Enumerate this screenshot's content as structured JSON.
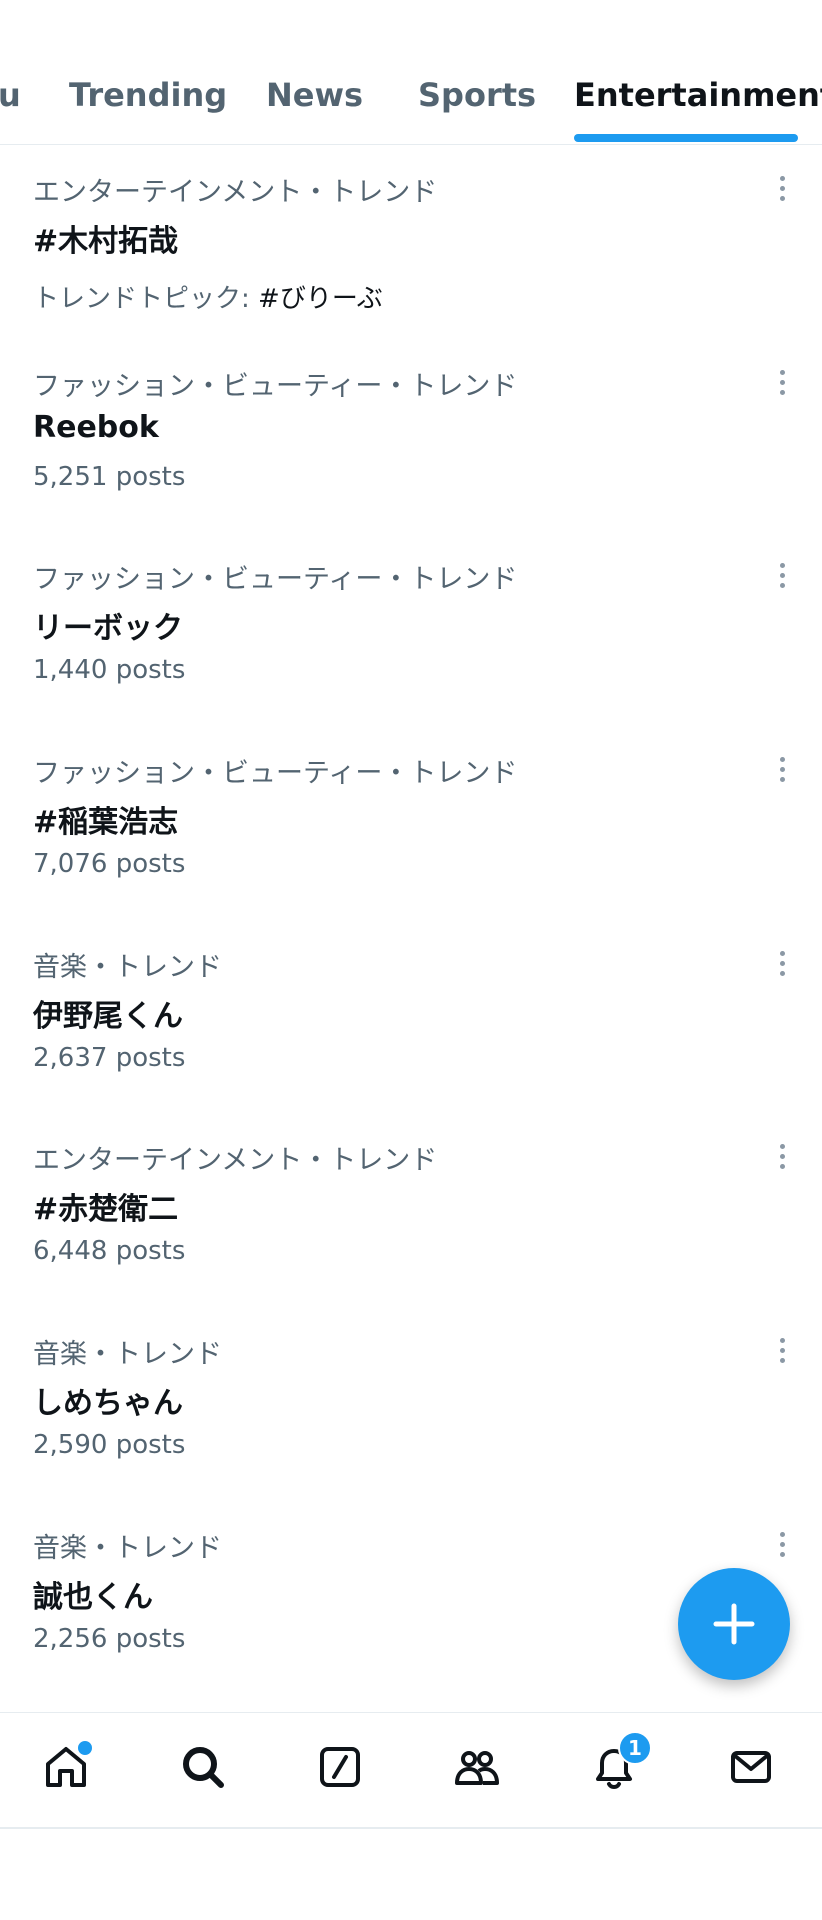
{
  "tabs": {
    "partial_label": "u",
    "items": [
      {
        "label": "Trending"
      },
      {
        "label": "News"
      },
      {
        "label": "Sports"
      },
      {
        "label": "Entertainment"
      }
    ],
    "active": "Entertainment"
  },
  "trends": [
    {
      "category": "エンターテインメント・トレンド",
      "title": "#木村拓哉",
      "meta_prefix": "トレンドトピック: ",
      "meta_link": "#びりーぶ"
    },
    {
      "category": "ファッション・ビューティー・トレンド",
      "title": "Reebok",
      "meta": "5,251 posts"
    },
    {
      "category": "ファッション・ビューティー・トレンド",
      "title": "リーボック",
      "meta": "1,440 posts"
    },
    {
      "category": "ファッション・ビューティー・トレンド",
      "title": "#稲葉浩志",
      "meta": "7,076 posts"
    },
    {
      "category": "音楽・トレンド",
      "title": "伊野尾くん",
      "meta": "2,637 posts"
    },
    {
      "category": "エンターテインメント・トレンド",
      "title": "#赤楚衛二",
      "meta": "6,448 posts"
    },
    {
      "category": "音楽・トレンド",
      "title": "しめちゃん",
      "meta": "2,590 posts"
    },
    {
      "category": "音楽・トレンド",
      "title": "誠也くん",
      "meta": "2,256 posts"
    }
  ],
  "fab": {
    "icon": "plus-icon"
  },
  "bottom_nav": {
    "items": [
      {
        "icon": "home-icon",
        "has_dot": true
      },
      {
        "icon": "search-icon"
      },
      {
        "icon": "compose-icon"
      },
      {
        "icon": "communities-icon"
      },
      {
        "icon": "notifications-icon",
        "badge": "1"
      },
      {
        "icon": "messages-icon"
      }
    ]
  },
  "colors": {
    "accent": "#1d9bf0",
    "text": "#0f1419",
    "secondary": "#536471",
    "border": "#e6ecf0"
  }
}
